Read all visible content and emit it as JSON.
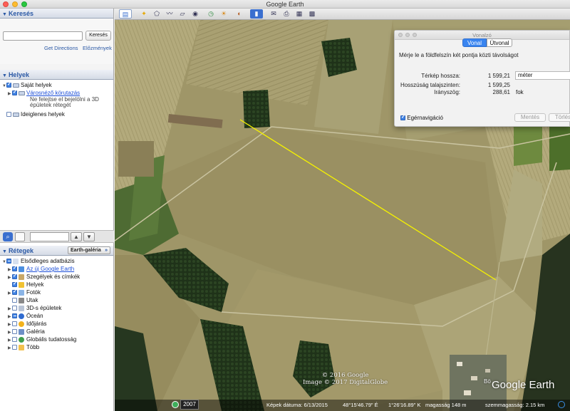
{
  "window": {
    "title": "Google Earth"
  },
  "search": {
    "header": "Keresés",
    "input_value": "",
    "button_label": "Keresés",
    "get_directions": "Get Directions",
    "history": "Előzmények"
  },
  "places": {
    "header": "Helyek",
    "items": [
      {
        "label": "Saját helyek"
      },
      {
        "label": "Városnéző körutazás"
      },
      {
        "label": "Ne felejtse el bejelölni a 3D"
      },
      {
        "label": "épületek rétegét"
      },
      {
        "label": "Ideiglenes helyek"
      }
    ]
  },
  "layers": {
    "header": "Rétegek",
    "gallery_button": "Earth-galéria",
    "items": [
      {
        "label": "Elsődleges adatbázis"
      },
      {
        "label": "Az új Google Earth"
      },
      {
        "label": "Szegélyek és címkék"
      },
      {
        "label": "Helyek"
      },
      {
        "label": "Fotók"
      },
      {
        "label": "Utak"
      },
      {
        "label": "3D-s épületek"
      },
      {
        "label": "Óceán"
      },
      {
        "label": "Időjárás"
      },
      {
        "label": "Galéria"
      },
      {
        "label": "Globális tudatosság"
      },
      {
        "label": "Több"
      }
    ]
  },
  "ruler": {
    "title": "Vonalzó",
    "tabs": [
      "Vonal",
      "Útvonal"
    ],
    "active_tab": "Vonal",
    "description": "Mérje le a földfelszín két pontja közti távolságot",
    "map_length_label": "Térkép hossza:",
    "map_length_value": "1 599,21",
    "ground_length_label": "Hosszúság talajszinten:",
    "ground_length_value": "1 599,25",
    "heading_label": "Irányszög:",
    "heading_value": "288,61",
    "unit_selected": "méter",
    "heading_unit": "fok",
    "mouse_nav_label": "Egérnavigáció",
    "mouse_nav_checked": true,
    "save_button": "Mentés",
    "clear_button": "Törlés"
  },
  "map": {
    "north_label": "N",
    "copyright_1": "© 2016 Google",
    "copyright_2": "Image © 2017 DigitalGlobe",
    "logo_text": "Google Earth",
    "town_label": "Bö",
    "measure_line_color": "#f5f200"
  },
  "status": {
    "history_year": "2007",
    "image_date": "Képek dátuma: 6/13/2015",
    "latitude": "48°15'46.79\" É",
    "longitude": "1°26'16.89\" K",
    "elevation": "magasság   148 m",
    "eye_altitude": "szemmagasság:  2.15 km"
  }
}
